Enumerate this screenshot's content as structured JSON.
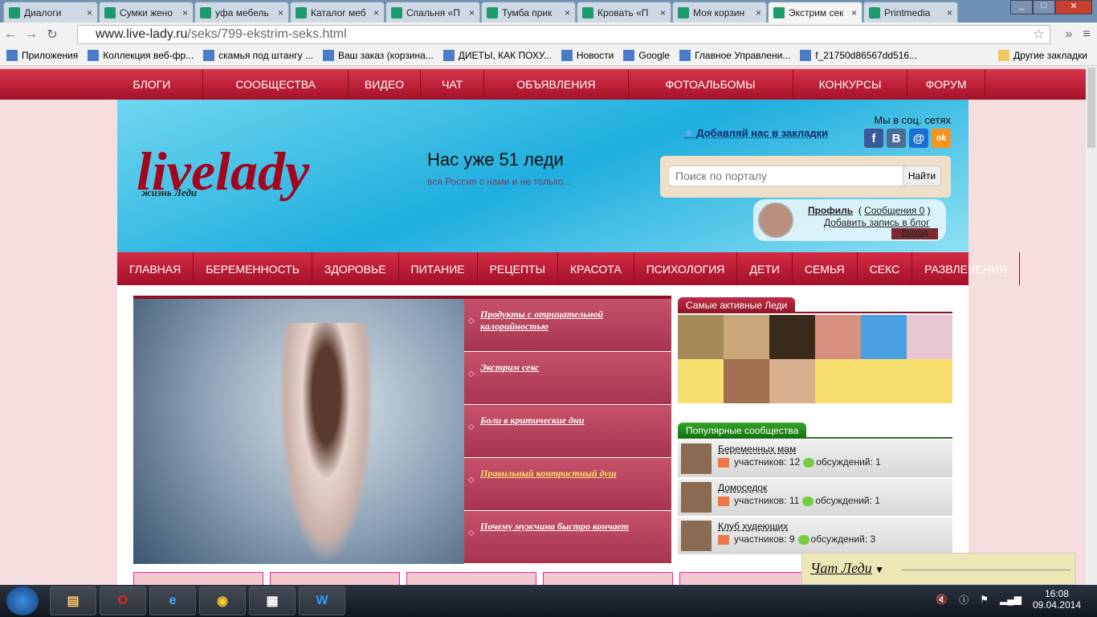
{
  "browser": {
    "tabs": [
      {
        "label": "Диалоги"
      },
      {
        "label": "Сумки жено"
      },
      {
        "label": "уфа мебель"
      },
      {
        "label": "Каталог меб"
      },
      {
        "label": "Спальня «П"
      },
      {
        "label": "Тумба прик"
      },
      {
        "label": "Кровать «П"
      },
      {
        "label": "Моя корзин"
      },
      {
        "label": "Экстрим сек"
      },
      {
        "label": "Printmedia"
      }
    ],
    "url_domain": "www.live-lady.ru",
    "url_path": "/seks/799-ekstrim-seks.html",
    "bookmarks": [
      {
        "label": "Приложения"
      },
      {
        "label": "Коллекция веб-фр..."
      },
      {
        "label": "скамья под штангу ..."
      },
      {
        "label": "Ваш заказ (корзина..."
      },
      {
        "label": "ДИЕТЫ, КАК ПОХУ..."
      },
      {
        "label": "Новости"
      },
      {
        "label": "Google"
      },
      {
        "label": "Главное Управлени..."
      },
      {
        "label": "f_21750d86567dd516..."
      }
    ],
    "other_bookmarks": "Другие закладки"
  },
  "topnav": [
    "БЛОГИ",
    "СООБЩЕСТВА",
    "ВИДЕО",
    "ЧАТ",
    "ОБЪЯВЛЕНИЯ",
    "ФОТОАЛЬБОМЫ",
    "КОНКУРСЫ",
    "ФОРУМ"
  ],
  "header": {
    "logo": "livelady",
    "logo_tagline": "жизнь Леди",
    "count": "Нас уже 51 леди",
    "subtitle": "вся Россия с нами и не только...",
    "add_bookmark": "Добавляй нас в закладки",
    "social_title": "Мы в соц. сетях",
    "social": [
      "f",
      "B",
      "@",
      "ok"
    ],
    "search_placeholder": "Поиск по порталу",
    "search_button": "Найти",
    "profile": "Профиль",
    "messages": "Сообщения 0",
    "add_post": "Добавить запись в блог",
    "exit": "Выход"
  },
  "catnav": [
    "ГЛАВНАЯ",
    "БЕРЕМЕННОСТЬ",
    "ЗДОРОВЬЕ",
    "ПИТАНИЕ",
    "РЕЦЕПТЫ",
    "КРАСОТА",
    "ПСИХОЛОГИЯ",
    "ДЕТИ",
    "СЕМЬЯ",
    "СЕКС",
    "РАЗВЛЕЧЕНИЯ"
  ],
  "articles": [
    "Продукты с отрицательной калорийностью",
    "Экстрим секс",
    "Боли в критические дни",
    "Правильный контрастный душ",
    "Почему мужчина быстро кончает"
  ],
  "sidebar": {
    "active_title": "Самые активные Леди",
    "communities_title": "Популярные сообщества",
    "communities": [
      {
        "name": "Беременных мам",
        "members": "участников: 12",
        "discussions": "обсуждений: 1"
      },
      {
        "name": "Домоседок",
        "members": "участников: 11",
        "discussions": "обсуждений: 1"
      },
      {
        "name": "Клуб худеющих",
        "members": "участников: 9",
        "discussions": "обсуждений: 3"
      }
    ]
  },
  "chat": "Чат Леди",
  "taskbar": {
    "time": "16:08",
    "date": "09.04.2014"
  }
}
